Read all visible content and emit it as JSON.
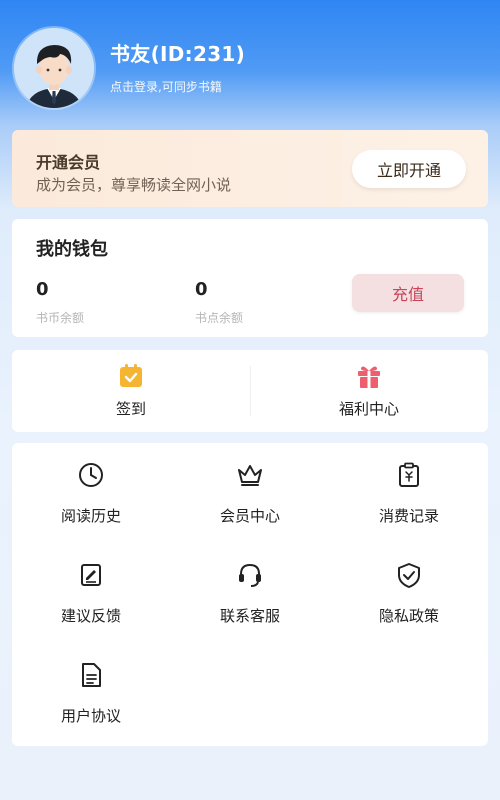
{
  "header": {
    "user_name": "书友(ID:231)",
    "subtitle": "点击登录,可同步书籍",
    "avatar_icon": "user-avatar"
  },
  "vip": {
    "title": "开通会员",
    "description": "成为会员，尊享畅读全网小说",
    "button_label": "立即开通"
  },
  "wallet": {
    "title": "我的钱包",
    "coins_value": "0",
    "coins_label": "书币余额",
    "points_value": "0",
    "points_label": "书点余额",
    "recharge_label": "充值",
    "recharge_color": "#c8455a"
  },
  "quick": {
    "items": [
      {
        "label": "签到",
        "icon": "calendar-check-icon",
        "color": "#f5b533"
      },
      {
        "label": "福利中心",
        "icon": "gift-icon",
        "color": "#ef5e6e"
      }
    ]
  },
  "menu": {
    "items": [
      {
        "label": "阅读历史",
        "icon": "clock-icon"
      },
      {
        "label": "会员中心",
        "icon": "crown-icon"
      },
      {
        "label": "消费记录",
        "icon": "receipt-icon"
      },
      {
        "label": "建议反馈",
        "icon": "edit-note-icon"
      },
      {
        "label": "联系客服",
        "icon": "headset-icon"
      },
      {
        "label": "隐私政策",
        "icon": "shield-icon"
      },
      {
        "label": "用户协议",
        "icon": "document-icon"
      }
    ]
  }
}
